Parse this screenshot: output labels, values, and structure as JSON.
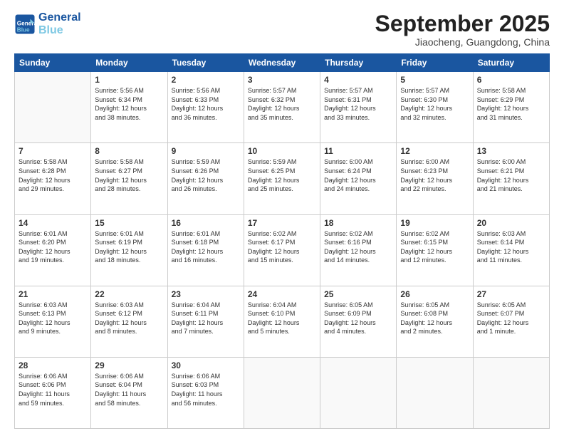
{
  "header": {
    "logo_line1": "General",
    "logo_line2": "Blue",
    "month": "September 2025",
    "location": "Jiaocheng, Guangdong, China"
  },
  "weekdays": [
    "Sunday",
    "Monday",
    "Tuesday",
    "Wednesday",
    "Thursday",
    "Friday",
    "Saturday"
  ],
  "weeks": [
    [
      {
        "day": "",
        "info": ""
      },
      {
        "day": "1",
        "info": "Sunrise: 5:56 AM\nSunset: 6:34 PM\nDaylight: 12 hours\nand 38 minutes."
      },
      {
        "day": "2",
        "info": "Sunrise: 5:56 AM\nSunset: 6:33 PM\nDaylight: 12 hours\nand 36 minutes."
      },
      {
        "day": "3",
        "info": "Sunrise: 5:57 AM\nSunset: 6:32 PM\nDaylight: 12 hours\nand 35 minutes."
      },
      {
        "day": "4",
        "info": "Sunrise: 5:57 AM\nSunset: 6:31 PM\nDaylight: 12 hours\nand 33 minutes."
      },
      {
        "day": "5",
        "info": "Sunrise: 5:57 AM\nSunset: 6:30 PM\nDaylight: 12 hours\nand 32 minutes."
      },
      {
        "day": "6",
        "info": "Sunrise: 5:58 AM\nSunset: 6:29 PM\nDaylight: 12 hours\nand 31 minutes."
      }
    ],
    [
      {
        "day": "7",
        "info": "Sunrise: 5:58 AM\nSunset: 6:28 PM\nDaylight: 12 hours\nand 29 minutes."
      },
      {
        "day": "8",
        "info": "Sunrise: 5:58 AM\nSunset: 6:27 PM\nDaylight: 12 hours\nand 28 minutes."
      },
      {
        "day": "9",
        "info": "Sunrise: 5:59 AM\nSunset: 6:26 PM\nDaylight: 12 hours\nand 26 minutes."
      },
      {
        "day": "10",
        "info": "Sunrise: 5:59 AM\nSunset: 6:25 PM\nDaylight: 12 hours\nand 25 minutes."
      },
      {
        "day": "11",
        "info": "Sunrise: 6:00 AM\nSunset: 6:24 PM\nDaylight: 12 hours\nand 24 minutes."
      },
      {
        "day": "12",
        "info": "Sunrise: 6:00 AM\nSunset: 6:23 PM\nDaylight: 12 hours\nand 22 minutes."
      },
      {
        "day": "13",
        "info": "Sunrise: 6:00 AM\nSunset: 6:21 PM\nDaylight: 12 hours\nand 21 minutes."
      }
    ],
    [
      {
        "day": "14",
        "info": "Sunrise: 6:01 AM\nSunset: 6:20 PM\nDaylight: 12 hours\nand 19 minutes."
      },
      {
        "day": "15",
        "info": "Sunrise: 6:01 AM\nSunset: 6:19 PM\nDaylight: 12 hours\nand 18 minutes."
      },
      {
        "day": "16",
        "info": "Sunrise: 6:01 AM\nSunset: 6:18 PM\nDaylight: 12 hours\nand 16 minutes."
      },
      {
        "day": "17",
        "info": "Sunrise: 6:02 AM\nSunset: 6:17 PM\nDaylight: 12 hours\nand 15 minutes."
      },
      {
        "day": "18",
        "info": "Sunrise: 6:02 AM\nSunset: 6:16 PM\nDaylight: 12 hours\nand 14 minutes."
      },
      {
        "day": "19",
        "info": "Sunrise: 6:02 AM\nSunset: 6:15 PM\nDaylight: 12 hours\nand 12 minutes."
      },
      {
        "day": "20",
        "info": "Sunrise: 6:03 AM\nSunset: 6:14 PM\nDaylight: 12 hours\nand 11 minutes."
      }
    ],
    [
      {
        "day": "21",
        "info": "Sunrise: 6:03 AM\nSunset: 6:13 PM\nDaylight: 12 hours\nand 9 minutes."
      },
      {
        "day": "22",
        "info": "Sunrise: 6:03 AM\nSunset: 6:12 PM\nDaylight: 12 hours\nand 8 minutes."
      },
      {
        "day": "23",
        "info": "Sunrise: 6:04 AM\nSunset: 6:11 PM\nDaylight: 12 hours\nand 7 minutes."
      },
      {
        "day": "24",
        "info": "Sunrise: 6:04 AM\nSunset: 6:10 PM\nDaylight: 12 hours\nand 5 minutes."
      },
      {
        "day": "25",
        "info": "Sunrise: 6:05 AM\nSunset: 6:09 PM\nDaylight: 12 hours\nand 4 minutes."
      },
      {
        "day": "26",
        "info": "Sunrise: 6:05 AM\nSunset: 6:08 PM\nDaylight: 12 hours\nand 2 minutes."
      },
      {
        "day": "27",
        "info": "Sunrise: 6:05 AM\nSunset: 6:07 PM\nDaylight: 12 hours\nand 1 minute."
      }
    ],
    [
      {
        "day": "28",
        "info": "Sunrise: 6:06 AM\nSunset: 6:06 PM\nDaylight: 11 hours\nand 59 minutes."
      },
      {
        "day": "29",
        "info": "Sunrise: 6:06 AM\nSunset: 6:04 PM\nDaylight: 11 hours\nand 58 minutes."
      },
      {
        "day": "30",
        "info": "Sunrise: 6:06 AM\nSunset: 6:03 PM\nDaylight: 11 hours\nand 56 minutes."
      },
      {
        "day": "",
        "info": ""
      },
      {
        "day": "",
        "info": ""
      },
      {
        "day": "",
        "info": ""
      },
      {
        "day": "",
        "info": ""
      }
    ]
  ]
}
